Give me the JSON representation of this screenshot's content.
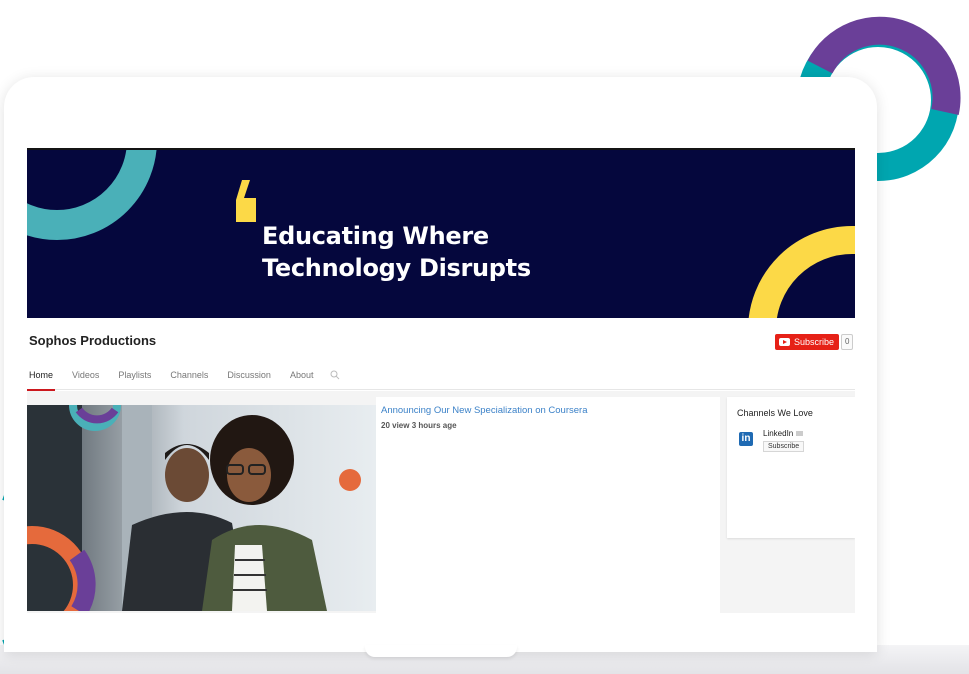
{
  "banner": {
    "line1": "Educating Where",
    "line2": "Technology Disrupts"
  },
  "channel": {
    "name": "Sophos Productions",
    "subscribe_label": "Subscribe",
    "subscriber_count": "0"
  },
  "tabs": [
    {
      "label": "Home",
      "active": true
    },
    {
      "label": "Videos"
    },
    {
      "label": "Playlists"
    },
    {
      "label": "Channels"
    },
    {
      "label": "Discussion"
    },
    {
      "label": "About"
    }
  ],
  "featured_video": {
    "title": "Announcing Our New Specialization on Coursera",
    "meta": "20 view 3 hours age"
  },
  "side_panel": {
    "title": "Channels We Love",
    "channels": [
      {
        "logo": "in",
        "name": "LinkedIn",
        "subscribe_label": "Subscribe"
      }
    ]
  },
  "icons": {
    "search": "search-icon",
    "youtube": "youtube-play-icon",
    "linkedin": "linkedin-icon",
    "quote": "quote-mark-icon"
  },
  "colors": {
    "banner_bg": "#05073d",
    "teal": "#4ab0b8",
    "yellow": "#fcd947",
    "purple": "#6a3f98",
    "subscribe_red": "#e62117",
    "link_blue": "#3c82c8",
    "accent_orange": "#e56a3c"
  }
}
